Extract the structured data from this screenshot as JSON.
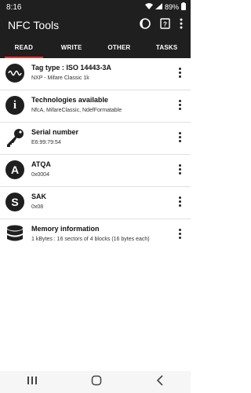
{
  "status": {
    "time": "8:16",
    "battery": "89%"
  },
  "app": {
    "title": "NFC Tools"
  },
  "tabs": [
    {
      "label": "READ"
    },
    {
      "label": "WRITE"
    },
    {
      "label": "OTHER"
    },
    {
      "label": "TASKS"
    }
  ],
  "items": [
    {
      "title": "Tag type : ISO 14443-3A",
      "subtitle": "NXP - Mifare Classic 1k",
      "icon": "wave-icon"
    },
    {
      "title": "Technologies available",
      "subtitle": "NfcA, MifareClassic, NdefFormatable",
      "icon": "info-icon"
    },
    {
      "title": "Serial number",
      "subtitle": "E6:99:79:54",
      "icon": "key-icon"
    },
    {
      "title": "ATQA",
      "subtitle": "0x0004",
      "icon": "letter-a-icon",
      "letter": "A"
    },
    {
      "title": "SAK",
      "subtitle": "0x08",
      "icon": "letter-s-icon",
      "letter": "S"
    },
    {
      "title": "Memory information",
      "subtitle": "1 kBytes : 16 sectors of 4 blocks (16 bytes each)",
      "icon": "database-icon"
    }
  ],
  "colors": {
    "accent": "#e53935",
    "appbar": "#1f1f1f"
  }
}
